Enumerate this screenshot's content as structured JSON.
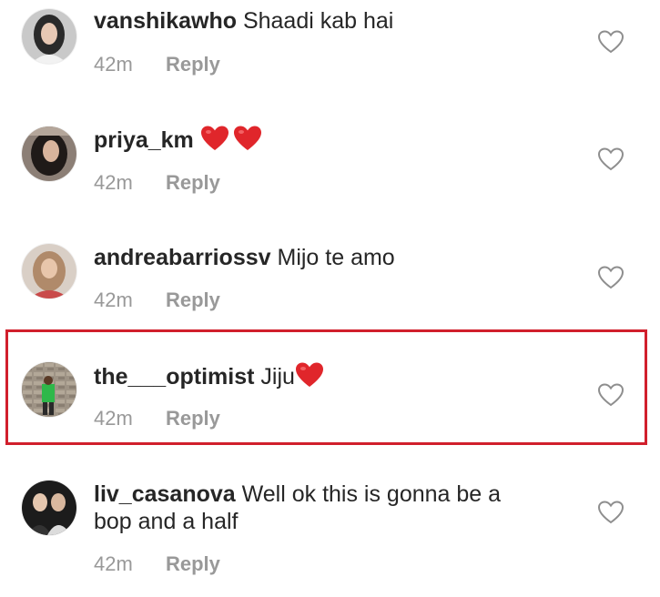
{
  "comments": [
    {
      "username": "vanshikawho",
      "text": "Shaadi kab hai",
      "time": "42m",
      "reply": "Reply"
    },
    {
      "username": "priya_km",
      "text": "",
      "time": "42m",
      "reply": "Reply",
      "emoji": "red-heart x2"
    },
    {
      "username": "andreabarriossv",
      "text": "Mijo te amo",
      "time": "42m",
      "reply": "Reply"
    },
    {
      "username": "the___optimist",
      "text": "Jiju",
      "time": "42m",
      "reply": "Reply",
      "emoji": "red-heart"
    },
    {
      "username": "liv_casanova",
      "text": "Well ok this is gonna be a",
      "text2": "bop and a half",
      "time": "42m",
      "reply": "Reply"
    }
  ],
  "colors": {
    "highlight_border": "#d11f2c",
    "heart_emoji": "#e0262b",
    "meta_text": "#999999",
    "primary_text": "#262626"
  },
  "icons": {
    "like": "heart-outline-icon",
    "emoji": "red-heart-emoji"
  },
  "highlighted_comment": "the___optimist"
}
